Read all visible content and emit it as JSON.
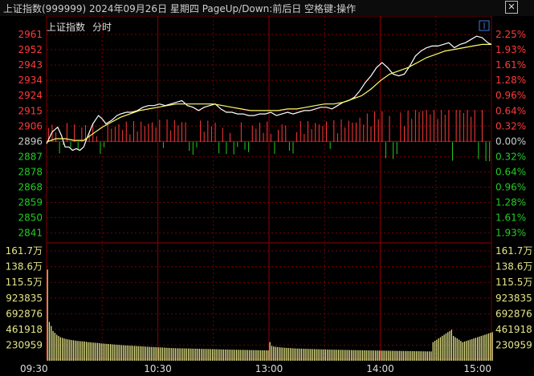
{
  "window": {
    "title": "上证指数(999999) 2024年09月26日 星期四 PageUp/Down:前后日 空格键:操作",
    "close_icon": "close-icon"
  },
  "chart_header": {
    "index_label": "上证指数",
    "mode_label": "分时"
  },
  "colors": {
    "price_line": "#ffffff",
    "avg_line": "#ffff66",
    "up": "#ff3a3a",
    "down": "#22cc22",
    "flat": "#cccccc",
    "volume": "#e6e68a",
    "grid": "#7a0000"
  },
  "chart_data": [
    {
      "type": "line",
      "title": "",
      "x_ticks": [
        "09:30",
        "10:30",
        "13:00",
        "14:00",
        "15:00"
      ],
      "prev_close": 2896,
      "ylim": [
        2837,
        2965
      ],
      "price_ticks": [
        2961,
        2952,
        2943,
        2934,
        2924,
        2915,
        2906,
        2896,
        2887,
        2878,
        2868,
        2859,
        2850,
        2841
      ],
      "pct_ticks": [
        "2.25%",
        "1.93%",
        "1.61%",
        "1.28%",
        "0.96%",
        "0.64%",
        "0.32%",
        "0.00%",
        "0.32%",
        "0.64%",
        "0.96%",
        "1.28%",
        "1.61%",
        "1.93%"
      ],
      "series": [
        {
          "role": "price",
          "x": [
            0,
            3,
            6,
            8,
            10,
            12,
            14,
            16,
            18,
            20,
            22,
            25,
            28,
            30,
            32,
            35,
            38,
            40,
            43,
            46,
            49,
            52,
            55,
            58,
            61,
            64,
            67,
            70,
            73,
            76,
            79,
            82,
            85,
            88,
            91,
            94,
            97,
            100,
            103,
            106,
            109,
            112,
            115,
            118,
            121,
            124,
            127,
            130,
            133,
            136,
            139,
            142,
            145,
            148,
            151,
            154,
            157,
            160,
            163,
            166,
            169,
            172,
            175,
            178,
            181,
            184,
            187,
            190,
            193,
            196,
            199,
            202,
            205,
            208,
            211,
            214,
            217,
            220,
            223,
            226,
            229,
            232,
            235,
            238,
            240
          ],
          "y": [
            2895,
            2902,
            2905,
            2900,
            2893,
            2893,
            2891,
            2892,
            2891,
            2893,
            2899,
            2907,
            2912,
            2910,
            2907,
            2909,
            2912,
            2913,
            2914,
            2914,
            2915,
            2917,
            2918,
            2918,
            2919,
            2918,
            2919,
            2920,
            2921,
            2918,
            2917,
            2915,
            2917,
            2918,
            2919,
            2916,
            2914,
            2914,
            2913,
            2913,
            2912,
            2912,
            2913,
            2913,
            2914,
            2912,
            2913,
            2914,
            2913,
            2914,
            2915,
            2915,
            2916,
            2917,
            2917,
            2916,
            2918,
            2920,
            2921,
            2923,
            2927,
            2932,
            2936,
            2941,
            2944,
            2941,
            2937,
            2936,
            2937,
            2942,
            2948,
            2951,
            2953,
            2954,
            2954,
            2955,
            2956,
            2953,
            2955,
            2956,
            2958,
            2960,
            2959,
            2956,
            2955
          ]
        },
        {
          "role": "average",
          "x": [
            0,
            5,
            10,
            15,
            20,
            25,
            30,
            35,
            40,
            45,
            50,
            55,
            60,
            65,
            70,
            75,
            80,
            85,
            90,
            95,
            100,
            105,
            110,
            115,
            120,
            125,
            130,
            135,
            140,
            145,
            150,
            155,
            160,
            165,
            170,
            175,
            180,
            185,
            190,
            195,
            200,
            205,
            210,
            215,
            220,
            225,
            230,
            235,
            240
          ],
          "y": [
            2896,
            2898,
            2898,
            2897,
            2897,
            2901,
            2905,
            2908,
            2911,
            2913,
            2915,
            2916,
            2917,
            2918,
            2919,
            2919,
            2919,
            2919,
            2919,
            2918,
            2917,
            2916,
            2915,
            2915,
            2915,
            2915,
            2916,
            2916,
            2917,
            2918,
            2919,
            2919,
            2920,
            2922,
            2924,
            2928,
            2933,
            2937,
            2939,
            2941,
            2944,
            2947,
            2949,
            2951,
            2952,
            2953,
            2954,
            2955,
            2955
          ]
        }
      ]
    },
    {
      "type": "bar",
      "title": "",
      "ylim": [
        0,
        1770000
      ],
      "y_ticks": [
        "161.7万",
        "138.6万",
        "115.5万",
        "923835",
        "692876",
        "461918",
        "230959"
      ],
      "x_ticks": [
        "09:30",
        "10:30",
        "13:00",
        "14:00",
        "15:00"
      ],
      "values": [
        1470000,
        625000,
        560000,
        480000,
        450000,
        420000,
        400000,
        380000,
        370000,
        360000,
        350000,
        345000,
        340000,
        335000,
        330000,
        325000,
        320000,
        318000,
        315000,
        312000,
        310000,
        305000,
        300000,
        298000,
        295000,
        292000,
        290000,
        288000,
        285000,
        280000,
        278000,
        275000,
        272000,
        270000,
        268000,
        265000,
        262000,
        260000,
        258000,
        255000,
        253000,
        250000,
        248000,
        246000,
        245000,
        243000,
        242000,
        240000,
        238000,
        236000,
        234000,
        232000,
        230000,
        228000,
        226000,
        225000,
        223000,
        222000,
        220000,
        218000,
        216000,
        215000,
        213000,
        212000,
        210000,
        208000,
        207000,
        205000,
        204000,
        203000,
        202000,
        201000,
        200000,
        200000,
        199000,
        198000,
        198000,
        197000,
        196000,
        195000,
        195000,
        194000,
        193000,
        192000,
        191000,
        190000,
        190000,
        189000,
        188000,
        187000,
        186000,
        186000,
        185000,
        184000,
        183000,
        182000,
        182000,
        181000,
        180000,
        180000,
        179000,
        178000,
        178000,
        177000,
        176000,
        176000,
        175000,
        175000,
        174000,
        173000,
        173000,
        172000,
        172000,
        171000,
        170000,
        170000,
        169000,
        168000,
        168000,
        167000,
        300000,
        240000,
        230000,
        225000,
        220000,
        218000,
        215000,
        212000,
        210000,
        208000,
        206000,
        204000,
        202000,
        200000,
        198000,
        197000,
        196000,
        195000,
        194000,
        193000,
        192000,
        191000,
        190000,
        189000,
        188000,
        187000,
        186000,
        185000,
        184000,
        183000,
        182000,
        181000,
        180000,
        180000,
        179000,
        178000,
        178000,
        177000,
        176000,
        176000,
        175000,
        175000,
        174000,
        173000,
        173000,
        172000,
        172000,
        171000,
        170000,
        170000,
        169000,
        168000,
        168000,
        167000,
        167000,
        166000,
        166000,
        165000,
        165000,
        164000,
        164000,
        163000,
        163000,
        162000,
        162000,
        161000,
        161000,
        160000,
        160000,
        159000,
        159000,
        158000,
        158000,
        157000,
        157000,
        156000,
        156000,
        155000,
        155000,
        154000,
        154000,
        153000,
        153000,
        152000,
        152000,
        151000,
        151000,
        150000,
        300000,
        320000,
        340000,
        360000,
        380000,
        400000,
        420000,
        440000,
        460000,
        480000,
        500000,
        400000,
        380000,
        360000,
        340000,
        320000,
        300000,
        310000,
        320000,
        330000,
        340000,
        350000,
        360000,
        370000,
        380000,
        390000,
        400000,
        410000,
        420000,
        430000,
        440000,
        450000,
        460000,
        470000,
        480000,
        490000,
        500000,
        400000,
        350000,
        300000,
        250000,
        200000
      ],
      "bar_step": 3
    }
  ]
}
